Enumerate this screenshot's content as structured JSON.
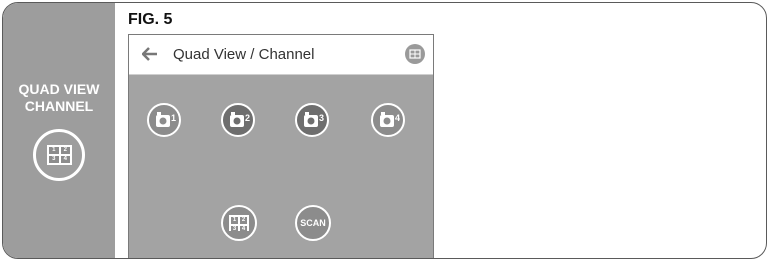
{
  "figure_label": "FIG. 5",
  "sidebar": {
    "title": "QUAD VIEW\nCHANNEL",
    "icon": "quad-grid-icon",
    "grid_numbers": [
      "1",
      "2",
      "3",
      "4"
    ]
  },
  "screen": {
    "title": "Quad View / Channel",
    "back_icon": "back-arrow-icon",
    "menu_icon": "menu-grid-icon",
    "cameras": [
      {
        "num": "1",
        "icon": "camera-icon"
      },
      {
        "num": "2",
        "icon": "camera-icon"
      },
      {
        "num": "3",
        "icon": "camera-icon"
      },
      {
        "num": "4",
        "icon": "camera-icon"
      }
    ],
    "quad_button_numbers": [
      "1",
      "2",
      "3",
      "4"
    ],
    "scan_label": "SCAN"
  },
  "colors": {
    "sidebar_bg": "#9d9d9d",
    "screen_bg": "#a3a3a3",
    "button_stroke": "#ffffff"
  }
}
